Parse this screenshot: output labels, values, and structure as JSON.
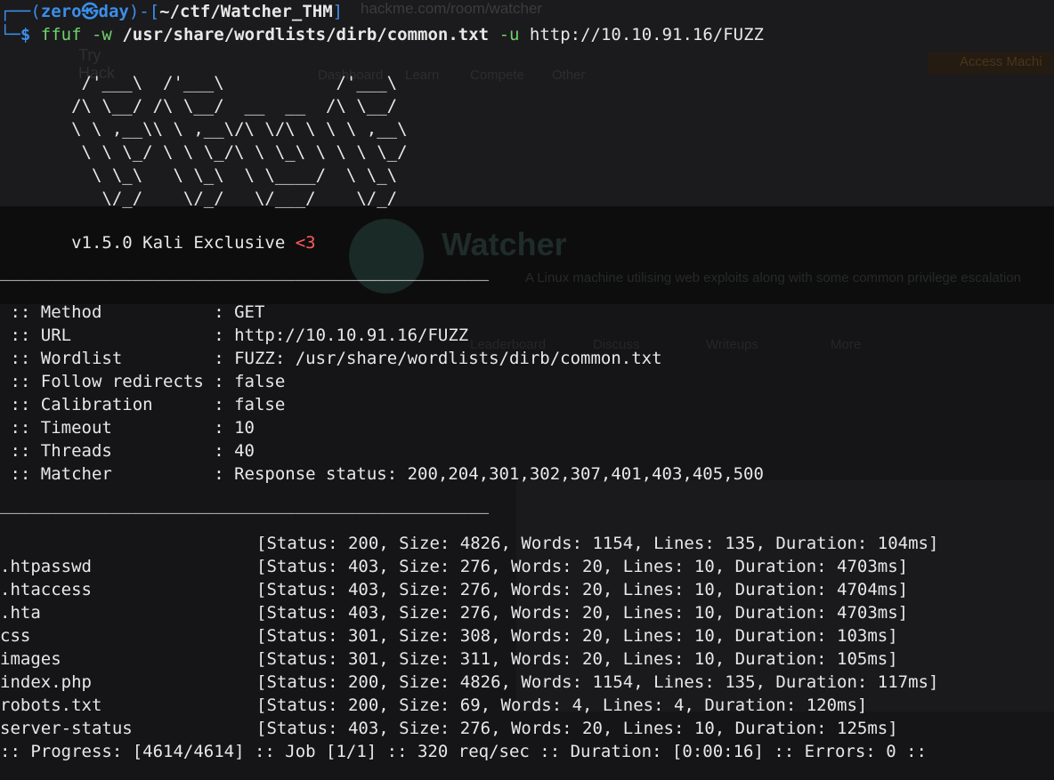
{
  "background": {
    "url": "hackme.com/room/watcher",
    "logo": "Try\nHack",
    "nav": [
      "Dashboard",
      "Learn",
      "Compete",
      "Other"
    ],
    "access_button": "Access Machi",
    "room_title": "Watcher",
    "room_desc": "A Linux machine utilising web exploits along with some common privilege escalation",
    "tabs": [
      "Leaderboard",
      "Discuss",
      "Writeups",
      "More"
    ]
  },
  "prompt": {
    "frame_top": "┌──(",
    "user": "zero㉿day",
    "mid": ")-[",
    "path": "~/ctf/Watcher_THM",
    "end": "]",
    "frame_bottom": "└─",
    "dollar": "$ ",
    "command": "ffuf",
    "opt_w": " -w ",
    "wordlist": "/usr/share/wordlists/dirb/common.txt",
    "opt_u": " -u ",
    "url": "http://10.10.91.16/FUZZ"
  },
  "banner": {
    "ascii": [
      "        /'___\\  /'___\\           /'___\\",
      "       /\\ \\__/ /\\ \\__/  __  __  /\\ \\__/",
      "       \\ \\ ,__\\\\ \\ ,__\\/\\ \\/\\ \\ \\ \\ ,__\\",
      "        \\ \\ \\_/ \\ \\ \\_/\\ \\ \\_\\ \\ \\ \\ \\_/",
      "         \\ \\_\\   \\ \\_\\  \\ \\____/  \\ \\_\\",
      "          \\/_/    \\/_/   \\/___/    \\/_/"
    ],
    "version": "       v1.5.0 Kali Exclusive ",
    "heart": "<3"
  },
  "divider": "________________________________________________",
  "config": [
    {
      "key": " :: Method           : ",
      "value": "GET"
    },
    {
      "key": " :: URL              : ",
      "value": "http://10.10.91.16/FUZZ"
    },
    {
      "key": " :: Wordlist         : ",
      "value": "FUZZ: /usr/share/wordlists/dirb/common.txt"
    },
    {
      "key": " :: Follow redirects : ",
      "value": "false"
    },
    {
      "key": " :: Calibration      : ",
      "value": "false"
    },
    {
      "key": " :: Timeout          : ",
      "value": "10"
    },
    {
      "key": " :: Threads          : ",
      "value": "40"
    },
    {
      "key": " :: Matcher          : ",
      "value": "Response status: 200,204,301,302,307,401,403,405,500"
    }
  ],
  "results": [
    {
      "path": "",
      "status": "[Status: 200, Size: 4826, Words: 1154, Lines: 135, Duration: 104ms]"
    },
    {
      "path": ".htpasswd",
      "status": "[Status: 403, Size: 276, Words: 20, Lines: 10, Duration: 4703ms]"
    },
    {
      "path": ".htaccess",
      "status": "[Status: 403, Size: 276, Words: 20, Lines: 10, Duration: 4704ms]"
    },
    {
      "path": ".hta",
      "status": "[Status: 403, Size: 276, Words: 20, Lines: 10, Duration: 4703ms]"
    },
    {
      "path": "css",
      "status": "[Status: 301, Size: 308, Words: 20, Lines: 10, Duration: 103ms]"
    },
    {
      "path": "images",
      "status": "[Status: 301, Size: 311, Words: 20, Lines: 10, Duration: 105ms]"
    },
    {
      "path": "index.php",
      "status": "[Status: 200, Size: 4826, Words: 1154, Lines: 135, Duration: 117ms]"
    },
    {
      "path": "robots.txt",
      "status": "[Status: 200, Size: 69, Words: 4, Lines: 4, Duration: 120ms]"
    },
    {
      "path": "server-status",
      "status": "[Status: 403, Size: 276, Words: 20, Lines: 10, Duration: 125ms]"
    }
  ],
  "progress": ":: Progress: [4614/4614] :: Job [1/1] :: 320 req/sec :: Duration: [0:00:16] :: Errors: 0 ::",
  "colors": {
    "prompt_blue": "#3b8eea",
    "command_green": "#6fd36f",
    "heart_red": "#ff5c57",
    "text": "#e8e8e8",
    "background": "#151416"
  }
}
